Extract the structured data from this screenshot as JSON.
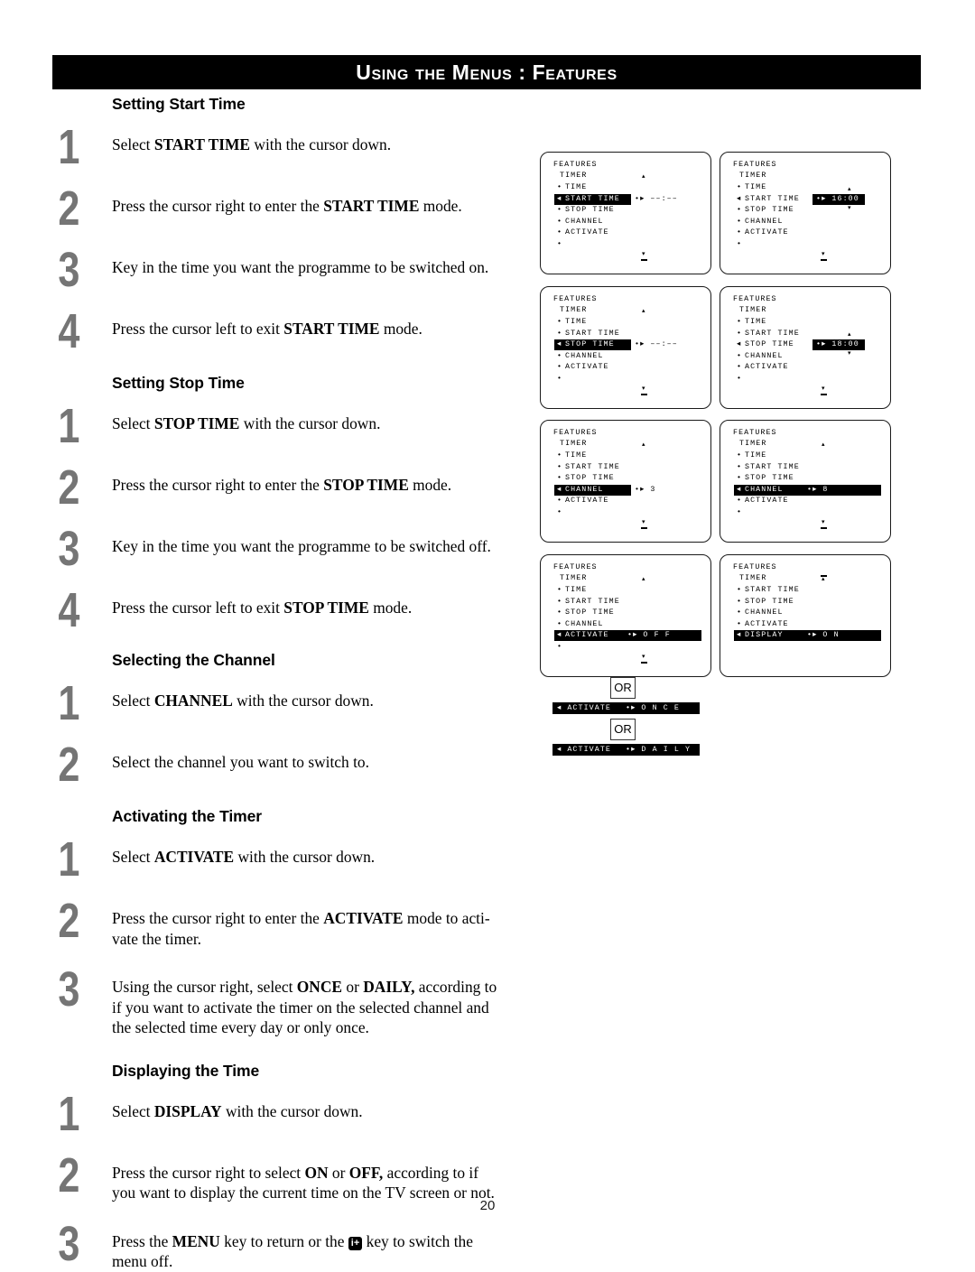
{
  "header": {
    "title": "Using the Menus : Features"
  },
  "page_number": "20",
  "sections": [
    {
      "heading": "Setting Start Time",
      "steps": [
        {
          "num": "1",
          "html": "Select <b>START TIME</b> with the cursor down."
        },
        {
          "num": "2",
          "html": "Press the cursor right to enter the <b>START TIME</b> mode."
        },
        {
          "num": "3",
          "html": "Key in the time you want the programme to be switched on."
        },
        {
          "num": "4",
          "html": "Press the cursor left to exit <b>START TIME</b> mode."
        }
      ]
    },
    {
      "heading": "Setting Stop Time",
      "steps": [
        {
          "num": "1",
          "html": "Select <b>STOP TIME</b> with the cursor down."
        },
        {
          "num": "2",
          "html": "Press the cursor right to enter the <b>STOP TIME</b> mode."
        },
        {
          "num": "3",
          "html": "Key in the time you want the programme to be switched off."
        },
        {
          "num": "4",
          "html": "Press the cursor left to exit <b>STOP TIME</b> mode."
        }
      ]
    },
    {
      "heading": "Selecting the Channel",
      "steps": [
        {
          "num": "1",
          "html": "Select <b>CHANNEL</b> with the cursor down."
        },
        {
          "num": "2",
          "html": "Select the channel you want to switch to."
        }
      ]
    },
    {
      "heading": "Activating the Timer",
      "steps": [
        {
          "num": "1",
          "html": "Select <b>ACTIVATE</b> with the cursor down."
        },
        {
          "num": "2",
          "html": "Press the cursor right to enter the <b>ACTIVATE</b> mode to acti-<br>vate the timer."
        },
        {
          "num": "3",
          "html": "Using the cursor right, select <b>ONCE</b> or <b>DAILY,</b> according to<br>if you want to activate the timer on the selected channel and<br>the selected time every day or only once."
        }
      ]
    },
    {
      "heading": "Displaying the Time",
      "steps": [
        {
          "num": "1",
          "html": "Select <b>DISPLAY</b> with the cursor down."
        },
        {
          "num": "2",
          "html": "Press the cursor right to select <b>ON</b> or <b>OFF,</b> according to if<br>you want to display the current time on the TV screen or not."
        },
        {
          "num": "3",
          "html": "Press the <b>MENU</b> key to return or the <span class=\"keyicon\">i+</span> key to switch the<br>menu off."
        }
      ]
    }
  ],
  "osd_panels": [
    {
      "id": "start-time-empty",
      "title": "FEATURES",
      "subtitle": "TIMER",
      "rows": [
        "TIME",
        "START TIME",
        "STOP TIME",
        "CHANNEL",
        "ACTIVATE",
        ""
      ],
      "highlight_index": 1,
      "highlight_width": 82,
      "value": "•▸ ––:––",
      "value_highlighted": false,
      "scroll_up": true,
      "scroll_down": true,
      "value_arrows": false
    },
    {
      "id": "start-time-1600",
      "title": "FEATURES",
      "subtitle": "TIMER",
      "rows": [
        "TIME",
        "START TIME",
        "STOP TIME",
        "CHANNEL",
        "ACTIVATE",
        ""
      ],
      "highlight_index": -1,
      "cursor_index": 1,
      "value": "•▸ 16:00",
      "value_highlighted": true,
      "scroll_up": false,
      "scroll_down": true,
      "value_arrows": true
    },
    {
      "id": "stop-time-empty",
      "title": "FEATURES",
      "subtitle": "TIMER",
      "rows": [
        "TIME",
        "START TIME",
        "STOP TIME",
        "CHANNEL",
        "ACTIVATE",
        ""
      ],
      "highlight_index": 2,
      "highlight_width": 82,
      "value": "•▸ ––:––",
      "value_highlighted": false,
      "scroll_up": true,
      "scroll_down": true,
      "value_arrows": false
    },
    {
      "id": "stop-time-1800",
      "title": "FEATURES",
      "subtitle": "TIMER",
      "rows": [
        "TIME",
        "START TIME",
        "STOP TIME",
        "CHANNEL",
        "ACTIVATE",
        ""
      ],
      "highlight_index": -1,
      "cursor_index": 2,
      "value": "•▸ 18:00",
      "value_highlighted": true,
      "scroll_up": false,
      "scroll_down": true,
      "value_arrows": true
    },
    {
      "id": "channel-3",
      "title": "FEATURES",
      "subtitle": "TIMER",
      "rows": [
        "TIME",
        "START TIME",
        "STOP TIME",
        "CHANNEL",
        "ACTIVATE",
        ""
      ],
      "highlight_index": 3,
      "highlight_width": 82,
      "value": "•▸ 3",
      "value_highlighted": false,
      "scroll_up": true,
      "scroll_down": true,
      "value_arrows": false
    },
    {
      "id": "channel-8",
      "title": "FEATURES",
      "subtitle": "TIMER",
      "rows": [
        "TIME",
        "START TIME",
        "STOP TIME",
        "CHANNEL",
        "ACTIVATE",
        ""
      ],
      "highlight_index": 3,
      "highlight_width": 160,
      "value": "•▸ 8",
      "value_inside": true,
      "value_highlighted": false,
      "scroll_up": true,
      "scroll_down": true,
      "value_arrows": false
    },
    {
      "id": "activate-off",
      "title": "FEATURES",
      "subtitle": "TIMER",
      "rows": [
        "TIME",
        "START TIME",
        "STOP TIME",
        "CHANNEL",
        "ACTIVATE",
        ""
      ],
      "highlight_index": 4,
      "highlight_width": 160,
      "value": "•▸ O F F",
      "value_inside": true,
      "value_highlighted": false,
      "scroll_up": true,
      "scroll_down": true,
      "value_arrows": false
    },
    {
      "id": "display-on",
      "title": "FEATURES",
      "subtitle": "TIMER",
      "rows": [
        "START TIME",
        "STOP TIME",
        "CHANNEL",
        "ACTIVATE",
        "DISPLAY"
      ],
      "highlight_index": 4,
      "highlight_width": 160,
      "value": "•▸ O N",
      "value_inside": true,
      "value_highlighted": false,
      "scroll_up": true,
      "scroll_up_bar": true,
      "scroll_down": false,
      "value_arrows": false
    }
  ],
  "or_section": {
    "or_label_1": "OR",
    "or_label_2": "OR",
    "bar_1": {
      "label": "◂ ACTIVATE",
      "value": "•▸ O N C E"
    },
    "bar_2": {
      "label": "◂ ACTIVATE",
      "value": "•▸ D A I L Y"
    }
  }
}
